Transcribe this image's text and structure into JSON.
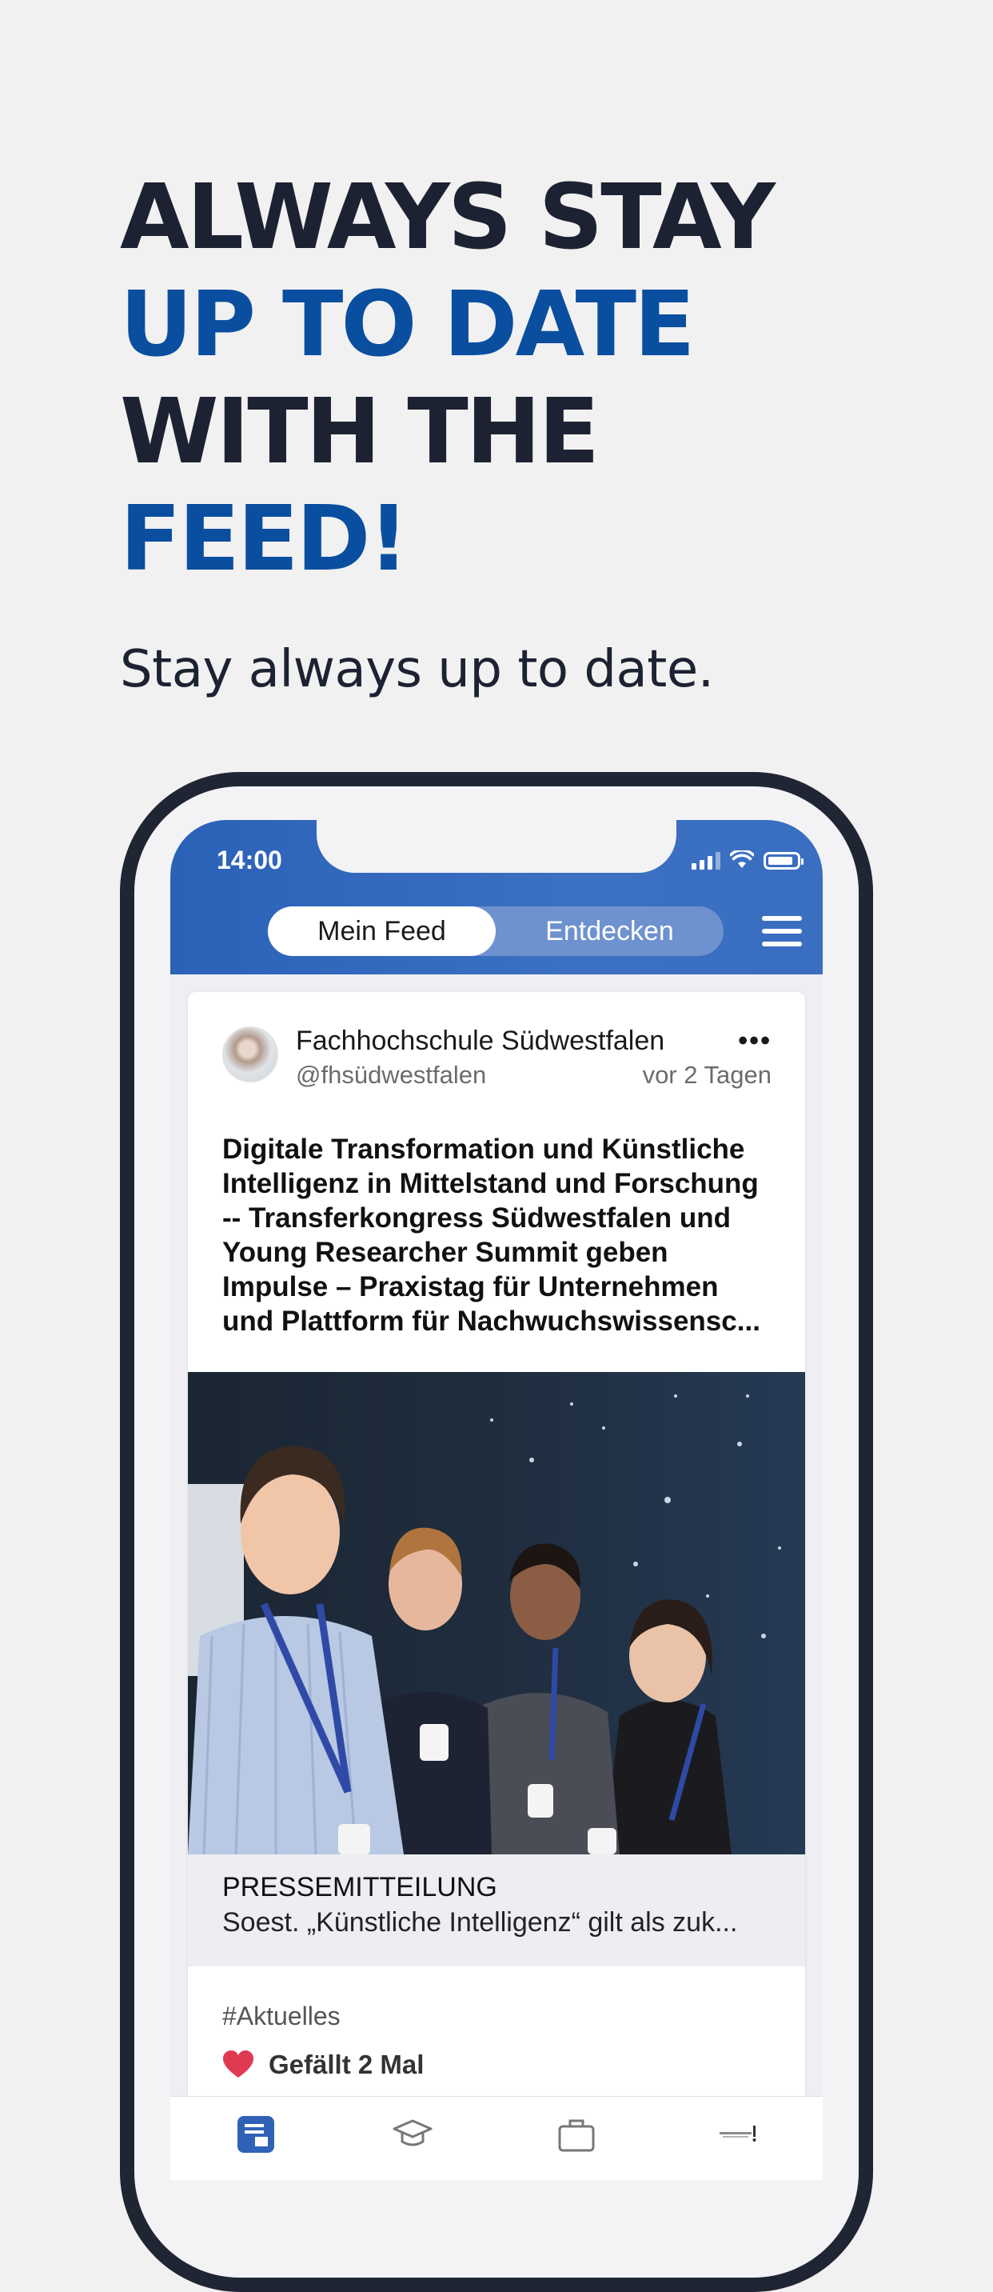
{
  "headline": {
    "line1": "ALWAYS STAY",
    "line2": "UP TO DATE",
    "line3": "WITH THE",
    "line4": "FEED!"
  },
  "subtitle": "Stay always up to date.",
  "colors": {
    "dark": "#1d2233",
    "accent": "#0a4ea0",
    "appbar": "#2f66bd"
  },
  "status_bar": {
    "time": "14:00",
    "icons": [
      "signal-icon",
      "wifi-icon",
      "battery-icon"
    ]
  },
  "tabs": {
    "mein_feed": "Mein Feed",
    "entdecken": "Entdecken",
    "active": "Mein Feed"
  },
  "post": {
    "author": "Fachhochschule Südwestfalen",
    "handle": "@fhsüdwestfalen",
    "time_ago": "vor 2 Tagen",
    "more": "•••",
    "title": "Digitale Transformation und Künstliche Intelligenz in Mittelstand und Forschung -- Transferkongress Südwestfalen und Young Researcher Summit geben Impulse – Praxistag für Unternehmen und Plattform für Nachwuchswissensc...",
    "press_tag": "PRESSEMITTEILUNG",
    "press_text": "Soest. „Künstliche Intelligenz“ gilt als zuk...",
    "hashtag": "#Aktuelles",
    "likes": "Gefällt 2 Mal"
  },
  "bottom_nav": [
    "feed-icon",
    "graduation-cap-icon",
    "briefcase-icon",
    "logo-icon"
  ]
}
